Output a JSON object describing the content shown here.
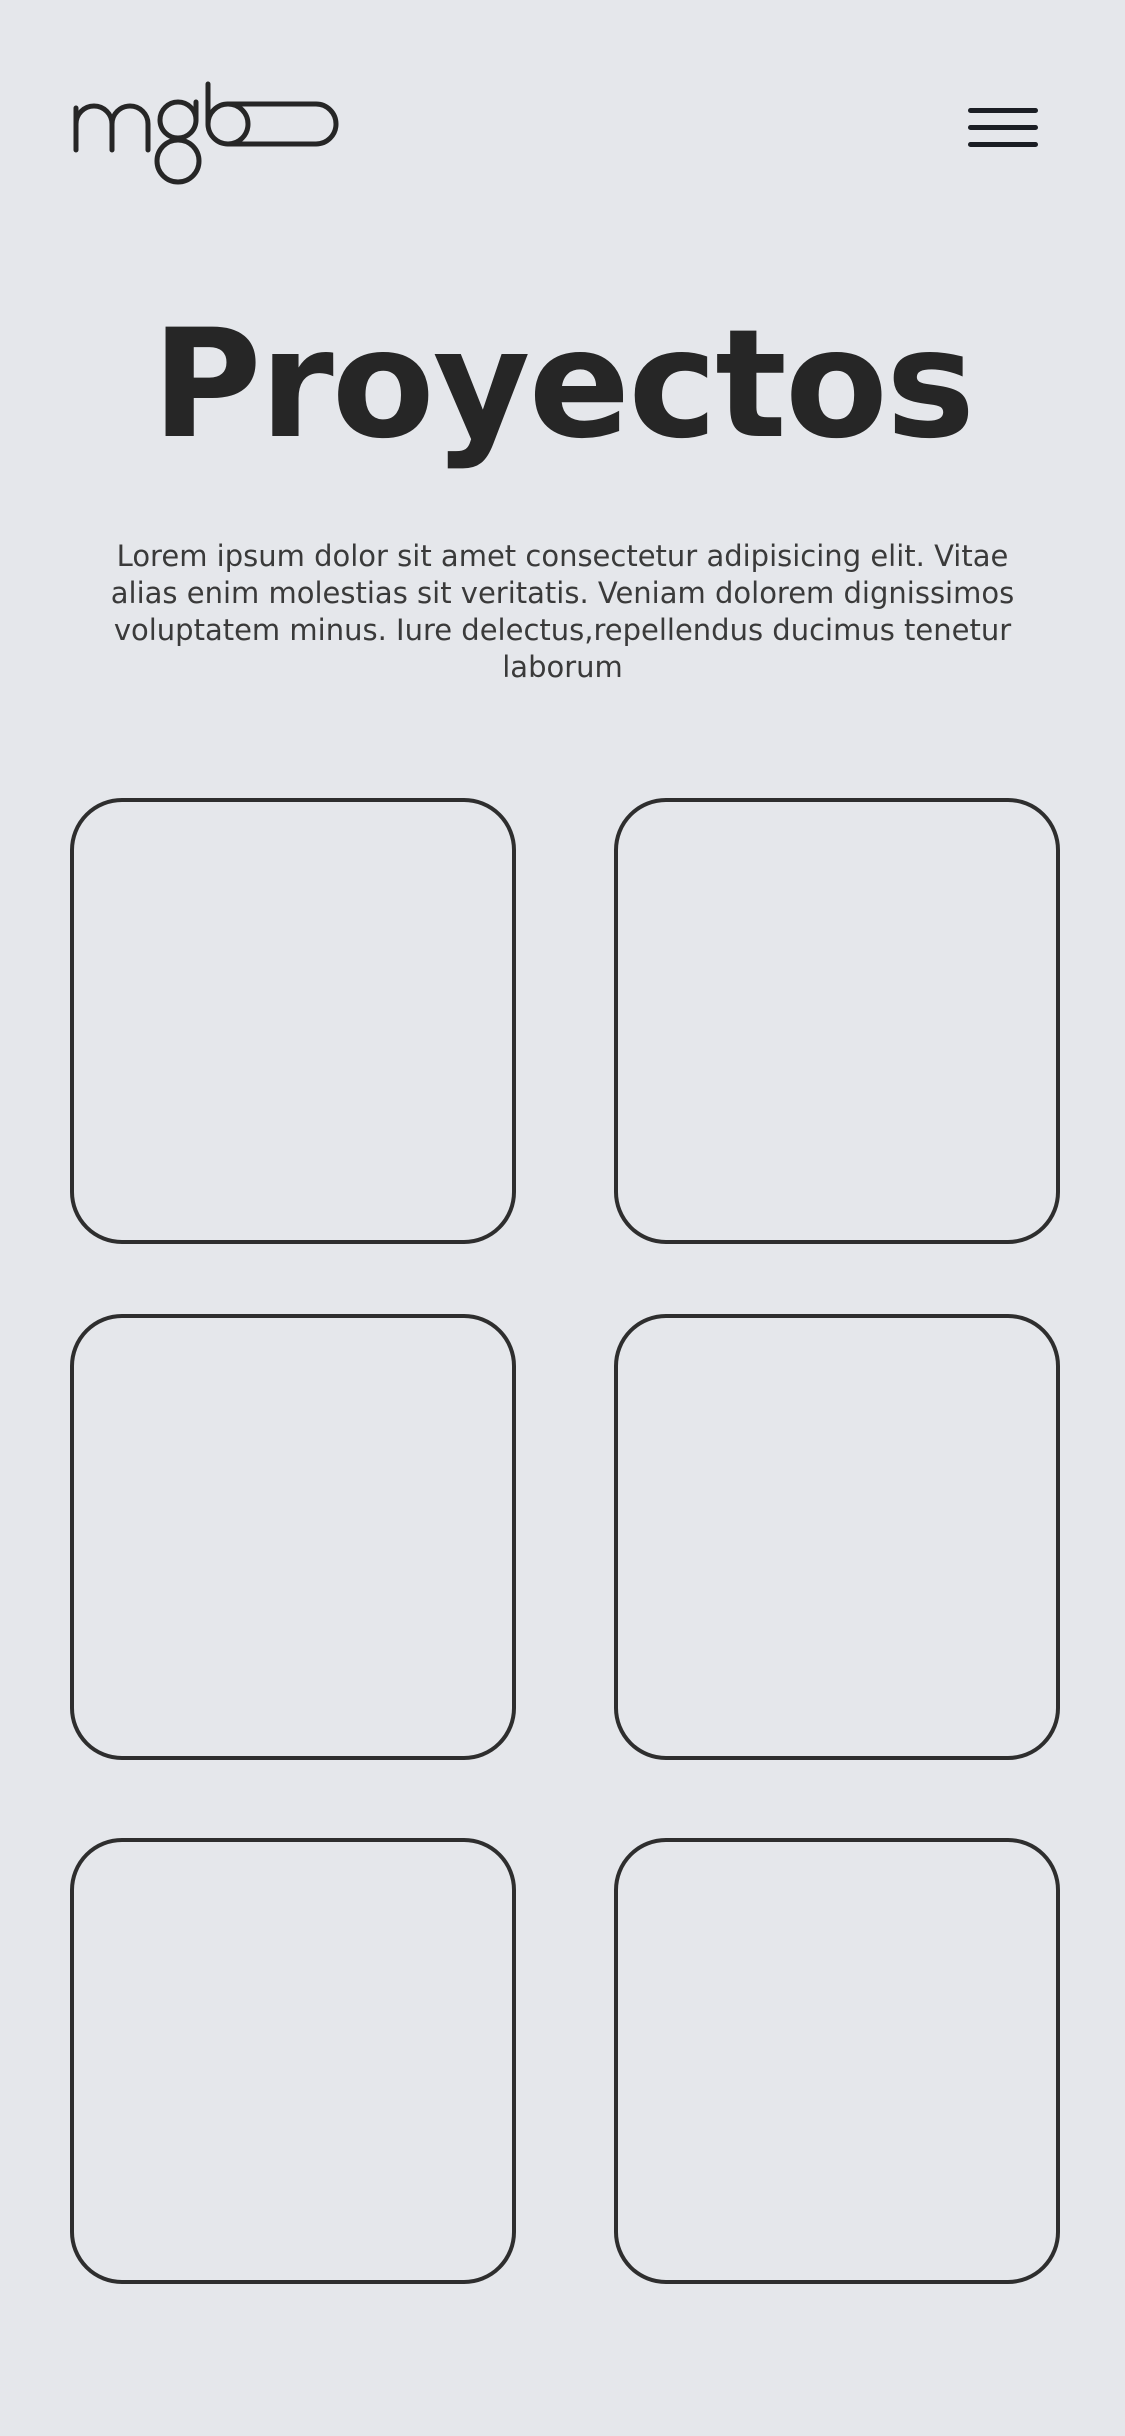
{
  "header": {
    "logo_text": "mgb",
    "logo_icon": "mgb-logo-icon",
    "menu_icon": "hamburger-menu-icon"
  },
  "main": {
    "title": "Proyectos",
    "description": "Lorem ipsum dolor sit amet consectetur adipisicing elit. Vitae alias enim molestias sit veritatis.  Veniam dolorem dignissimos voluptatem minus. Iure delectus,repellendus ducimus tenetur laborum",
    "projects": [
      {},
      {},
      {},
      {},
      {},
      {}
    ]
  },
  "colors": {
    "background": "#E5E7EB",
    "text": "#262626",
    "card_border": "#2E2E2E",
    "menu_icon": "#1B1E24"
  }
}
